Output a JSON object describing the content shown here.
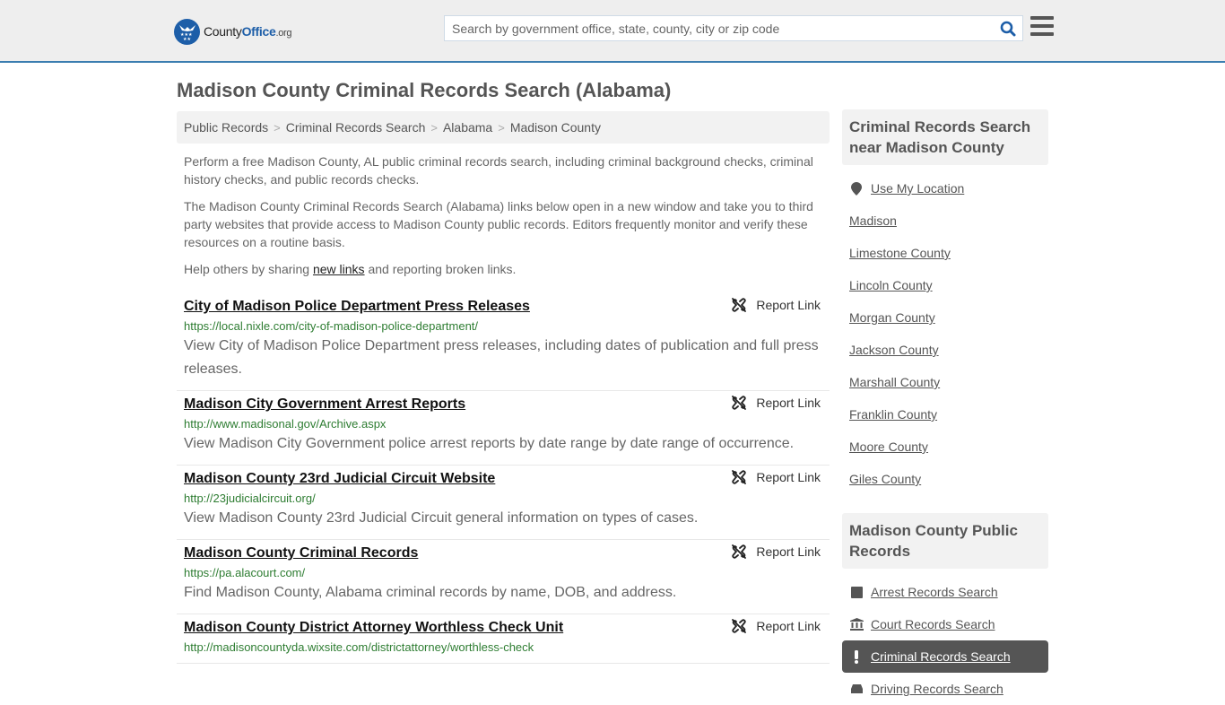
{
  "header": {
    "logo": {
      "name": "County",
      "name_bold": "Office",
      "suffix": ".org"
    },
    "search": {
      "placeholder": "Search by government office, state, county, city or zip code",
      "value": ""
    },
    "colors": {
      "brand": "#1d5ea8",
      "accent_line": "#3b7db0"
    }
  },
  "page": {
    "title": "Madison County Criminal Records Search (Alabama)",
    "breadcrumb": [
      "Public Records",
      "Criminal Records Search",
      "Alabama",
      "Madison County"
    ],
    "intro": {
      "p1": "Perform a free Madison County, AL public criminal records search, including criminal background checks, criminal history checks, and public records checks.",
      "p2": "The Madison County Criminal Records Search (Alabama) links below open in a new window and take you to third party websites that provide access to Madison County public records. Editors frequently monitor and verify these resources on a routine basis.",
      "p3_before": "Help others by sharing ",
      "p3_link": "new links",
      "p3_after": " and reporting broken links."
    },
    "report_label": "Report Link",
    "results": [
      {
        "title": "City of Madison Police Department Press Releases",
        "url": "https://local.nixle.com/city-of-madison-police-department/",
        "desc": "View City of Madison Police Department press releases, including dates of publication and full press releases."
      },
      {
        "title": "Madison City Government Arrest Reports",
        "url": "http://www.madisonal.gov/Archive.aspx",
        "desc": "View Madison City Government police arrest reports by date range by date range of occurrence."
      },
      {
        "title": "Madison County 23rd Judicial Circuit Website",
        "url": "http://23judicialcircuit.org/",
        "desc": "View Madison County 23rd Judicial Circuit general information on types of cases."
      },
      {
        "title": "Madison County Criminal Records",
        "url": "https://pa.alacourt.com/",
        "desc": "Find Madison County, Alabama criminal records by name, DOB, and address."
      },
      {
        "title": "Madison County District Attorney Worthless Check Unit",
        "url": "http://madisoncountyda.wixsite.com/districtattorney/worthless-check",
        "desc": ""
      }
    ]
  },
  "sidebar": {
    "nearby": {
      "heading": "Criminal Records Search near Madison County",
      "use_location": "Use My Location",
      "items": [
        "Madison",
        "Limestone County",
        "Lincoln County",
        "Morgan County",
        "Jackson County",
        "Marshall County",
        "Franklin County",
        "Moore County",
        "Giles County"
      ]
    },
    "public_records": {
      "heading": "Madison County Public Records",
      "items": [
        {
          "label": "Arrest Records Search",
          "icon": "square-icon",
          "active": false
        },
        {
          "label": "Court Records Search",
          "icon": "courthouse-icon",
          "active": false
        },
        {
          "label": "Criminal Records Search",
          "icon": "exclamation-icon",
          "active": true
        },
        {
          "label": "Driving Records Search",
          "icon": "car-icon",
          "active": false
        }
      ]
    }
  }
}
